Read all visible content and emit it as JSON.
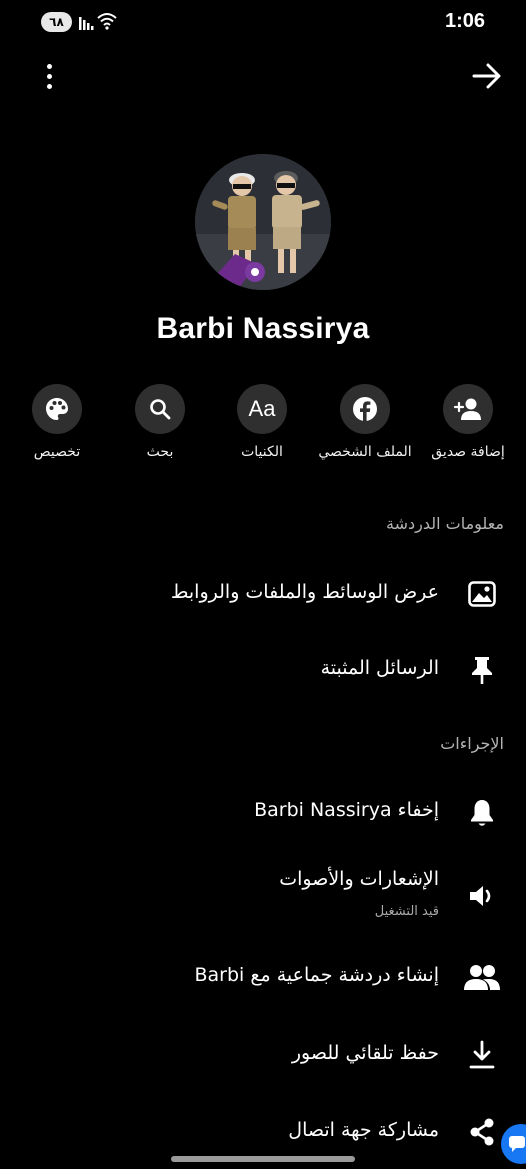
{
  "status_bar": {
    "battery_level": "٦٨",
    "time": "1:06",
    "icons": [
      "battery-icon",
      "signal-icon",
      "wifi-icon"
    ]
  },
  "top_bar": {
    "menu_icon": "more-vertical-icon",
    "forward_icon": "arrow-right-icon"
  },
  "profile": {
    "name": "Barbi Nassirya"
  },
  "actions": [
    {
      "label": "إضافة صديق",
      "icon": "add-friend-icon"
    },
    {
      "label": "الملف الشخصي",
      "icon": "facebook-icon"
    },
    {
      "label": "الكنيات",
      "icon": "nicknames-icon"
    },
    {
      "label": "بحث",
      "icon": "search-icon"
    },
    {
      "label": "تخصيص",
      "icon": "palette-icon"
    }
  ],
  "chat_info": {
    "header": "معلومات الدردشة",
    "items": [
      {
        "title": "عرض الوسائط والملفات والروابط",
        "icon": "image-icon"
      },
      {
        "title": "الرسائل المثبتة",
        "icon": "pin-icon"
      }
    ]
  },
  "actions_section": {
    "header": "الإجراءات",
    "items": [
      {
        "title": "إخفاء Barbi Nassirya",
        "icon": "bell-icon"
      },
      {
        "title": "الإشعارات والأصوات",
        "subtitle": "قيد التشغيل",
        "icon": "speaker-icon"
      },
      {
        "title": "إنشاء دردشة جماعية مع Barbi",
        "icon": "group-icon"
      },
      {
        "title": "حفظ تلقائي للصور",
        "icon": "download-icon"
      },
      {
        "title": "مشاركة جهة اتصال",
        "icon": "share-icon"
      }
    ]
  },
  "colors": {
    "background": "#000000",
    "button_circle": "#2f2f2f",
    "secondary_text": "#b3b3b3",
    "accent": "#1877f2"
  }
}
